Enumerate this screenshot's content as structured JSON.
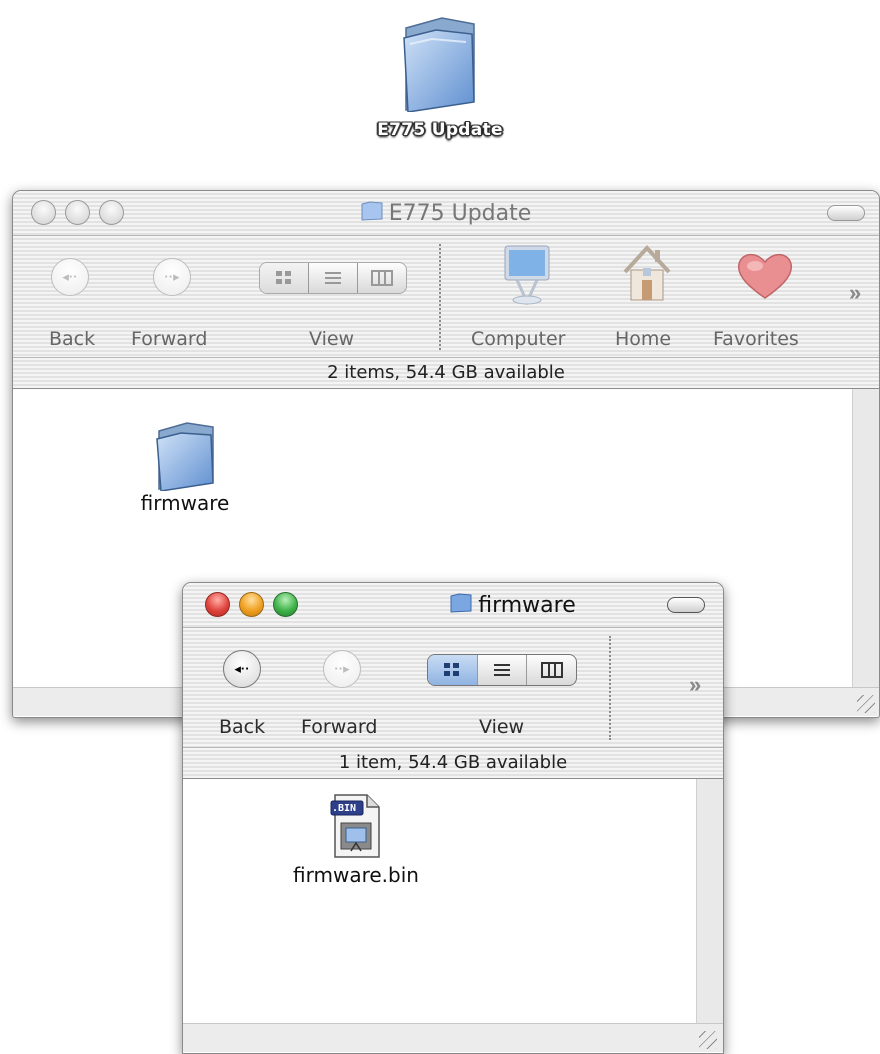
{
  "desktop": {
    "icon_label": "E775 Update"
  },
  "window_back": {
    "title": "E775 Update",
    "toolbar": {
      "back": "Back",
      "forward": "Forward",
      "view": "View",
      "computer": "Computer",
      "home": "Home",
      "favorites": "Favorites"
    },
    "status": "2 items, 54.4 GB available",
    "items": [
      {
        "label": "firmware",
        "icon": "folder-icon"
      }
    ]
  },
  "window_front": {
    "title": "firmware",
    "toolbar": {
      "back": "Back",
      "forward": "Forward",
      "view": "View"
    },
    "status": "1 item, 54.4 GB available",
    "items": [
      {
        "label": "firmware.bin",
        "icon": "bin-file-icon",
        "badge": ".BIN"
      }
    ]
  },
  "colors": {
    "close": "#e0443e",
    "minimize": "#f0a021",
    "zoom": "#3fb24a",
    "inactive_light": "#d8d8d8",
    "selection": "#8fb3e2",
    "folder_blue": "#6f9fdc"
  }
}
